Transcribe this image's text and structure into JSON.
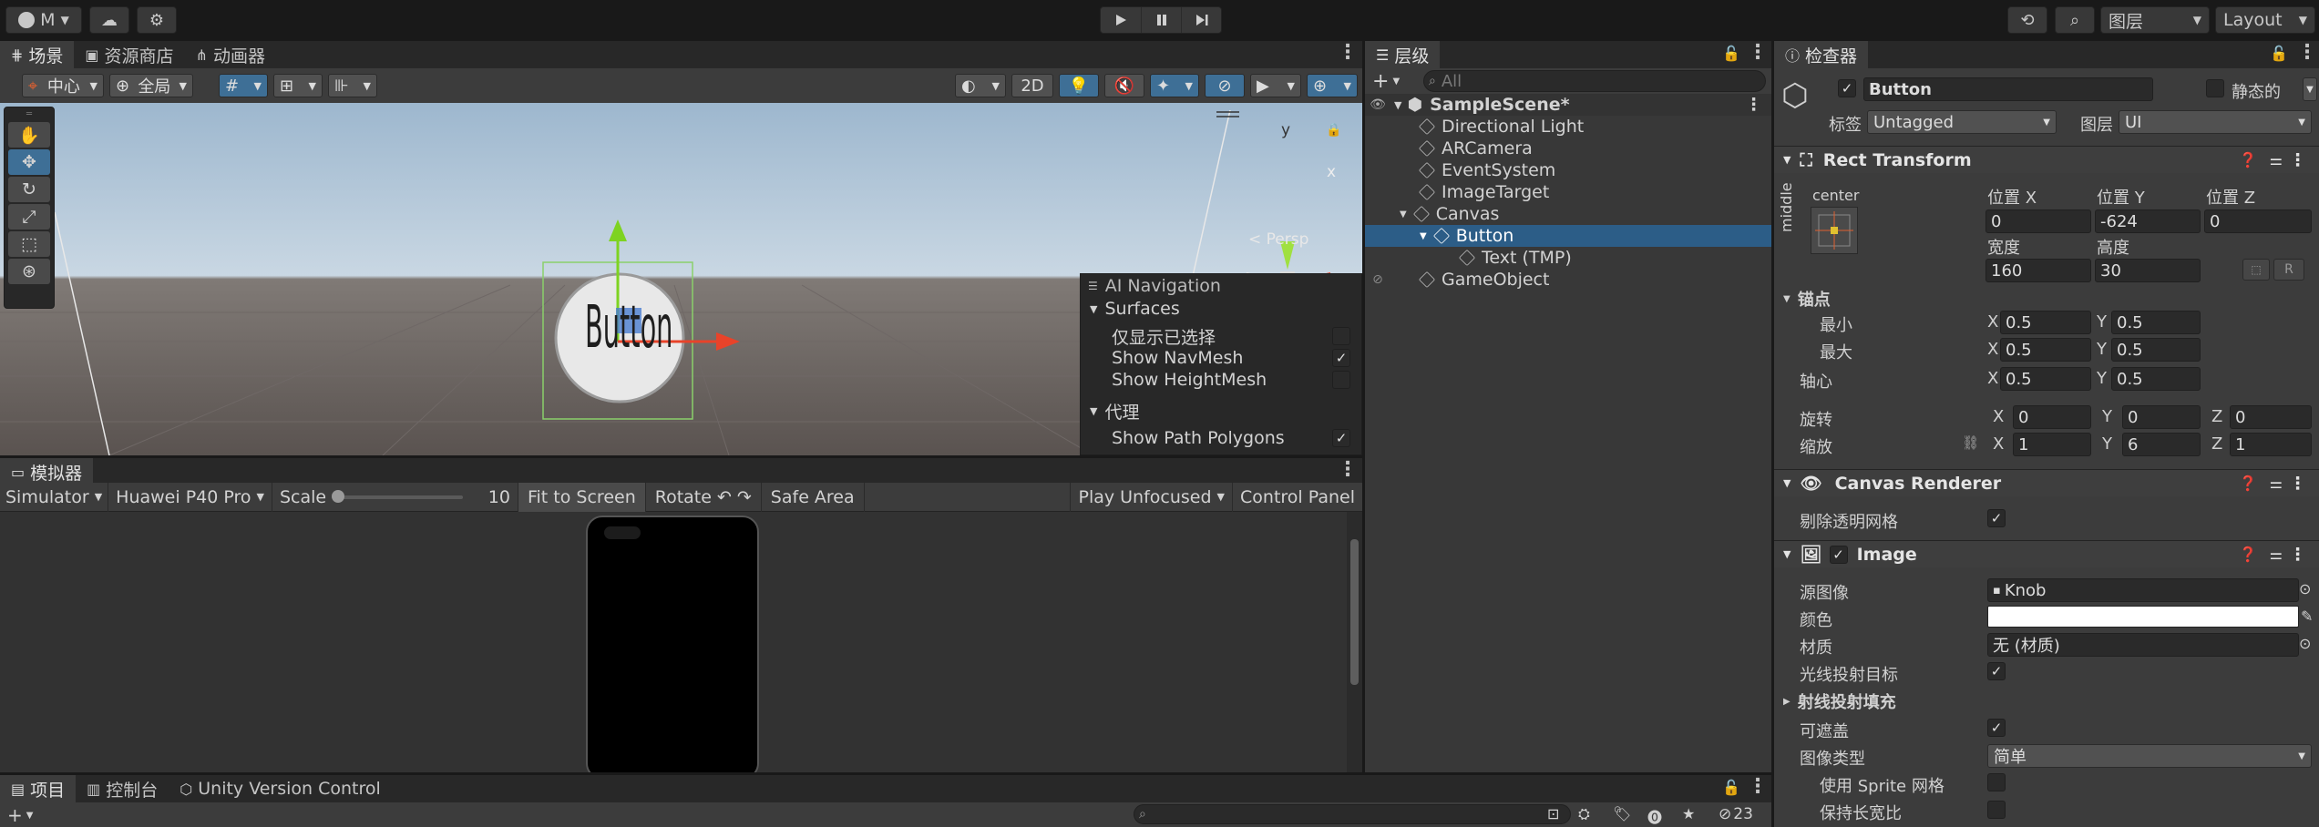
{
  "toolbar": {
    "account_label": "M",
    "layers_label": "图层",
    "layout_label": "Layout",
    "play_icon": "play-icon",
    "pause_icon": "pause-icon",
    "step_icon": "step-icon"
  },
  "scene_tabs": [
    {
      "label": "场景"
    },
    {
      "label": "资源商店"
    },
    {
      "label": "动画器"
    }
  ],
  "scene_toolbar": {
    "pivot_label": "中心",
    "global_label": "全局",
    "mode_2d": "2D"
  },
  "scene": {
    "button_text": "Button",
    "persp_label": "< Persp",
    "gizmo_y": "y",
    "gizmo_x": "x"
  },
  "ai_nav": {
    "title": "AI Navigation",
    "surfaces_label": "Surfaces",
    "items": [
      {
        "label": "仅显示已选择",
        "checked": false
      },
      {
        "label": "Show NavMesh",
        "checked": true
      },
      {
        "label": "Show HeightMesh",
        "checked": false
      }
    ],
    "agent_label": "代理",
    "agent_items": [
      {
        "label": "Show Path Polygons",
        "checked": true
      }
    ]
  },
  "simulator": {
    "tab_label": "模拟器",
    "mode": "Simulator",
    "device": "Huawei P40 Pro",
    "scale_label": "Scale",
    "scale_value": "10",
    "fit_label": "Fit to Screen",
    "rotate_label": "Rotate",
    "safe_area_label": "Safe Area",
    "play_mode": "Play Unfocused",
    "control_panel": "Control Panel"
  },
  "hierarchy": {
    "tab_label": "层级",
    "search_placeholder": "All",
    "scene_name": "SampleScene*",
    "items": [
      {
        "label": "Directional Light",
        "depth": 1
      },
      {
        "label": "ARCamera",
        "depth": 1
      },
      {
        "label": "EventSystem",
        "depth": 1
      },
      {
        "label": "ImageTarget",
        "depth": 1
      },
      {
        "label": "Canvas",
        "depth": 1
      },
      {
        "label": "Button",
        "depth": 2,
        "selected": true
      },
      {
        "label": "Text (TMP)",
        "depth": 3
      },
      {
        "label": "GameObject",
        "depth": 1
      }
    ]
  },
  "inspector": {
    "tab_label": "检查器",
    "object_name": "Button",
    "static_label": "静态的",
    "tag_label": "标签",
    "tag_value": "Untagged",
    "layer_label": "图层",
    "layer_value": "UI",
    "rect_transform": {
      "title": "Rect Transform",
      "anchor_h": "center",
      "anchor_v": "middle",
      "pos_x_label": "位置 X",
      "pos_y_label": "位置 Y",
      "pos_z_label": "位置 Z",
      "pos_x": "0",
      "pos_y": "-624",
      "pos_z": "0",
      "width_label": "宽度",
      "height_label": "高度",
      "width": "160",
      "height": "30",
      "anchors_label": "锚点",
      "min_label": "最小",
      "max_label": "最大",
      "pivot_label": "轴心",
      "min_x": "0.5",
      "min_y": "0.5",
      "max_x": "0.5",
      "max_y": "0.5",
      "pivot_x": "0.5",
      "pivot_y": "0.5",
      "rotation_label": "旋转",
      "scale_label": "缩放",
      "rot_x": "0",
      "rot_y": "0",
      "rot_z": "0",
      "scale_x": "1",
      "scale_y": "6",
      "scale_z": "1",
      "r_label": "R"
    },
    "canvas_renderer": {
      "title": "Canvas Renderer",
      "cull_label": "剔除透明网格"
    },
    "image": {
      "title": "Image",
      "source_label": "源图像",
      "source_value": "Knob",
      "color_label": "颜色",
      "material_label": "材质",
      "material_value": "无 (材质)",
      "raycast_label": "光线投射目标",
      "raycast_padding_label": "射线投射填充",
      "maskable_label": "可遮盖",
      "image_type_label": "图像类型",
      "image_type_value": "简单",
      "use_sprite_mesh_label": "使用 Sprite 网格",
      "preserve_aspect_label": "保持长宽比"
    }
  },
  "bottom_tabs": [
    {
      "label": "项目"
    },
    {
      "label": "控制台"
    },
    {
      "label": "Unity Version Control"
    }
  ],
  "bottom_status": {
    "hidden_count": "23"
  },
  "colors": {
    "accent": "#2c5d87",
    "selected_row": "#2c5d87",
    "panel": "#3c3c3c",
    "sky": "#a9c0d6",
    "ground": "#5c5552"
  }
}
